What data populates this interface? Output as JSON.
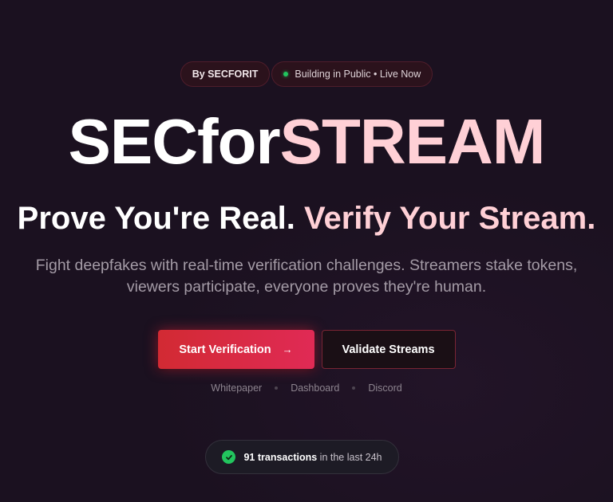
{
  "badges": {
    "author": "By SECFORIT",
    "status": "Building in Public • Live Now"
  },
  "hero": {
    "title_part1": "SECfor",
    "title_part2": "STREAM",
    "tagline_part1": "Prove You're Real.",
    "tagline_part2": "Verify Your Stream.",
    "description": "Fight deepfakes with real-time verification challenges. Streamers stake tokens, viewers participate, everyone proves they're human."
  },
  "actions": {
    "primary_label": "Start Verification",
    "primary_icon": "arrow-right-icon",
    "secondary_label": "Validate Streams"
  },
  "links": [
    "Whitepaper",
    "Dashboard",
    "Discord"
  ],
  "stats": {
    "count_label": "91 transactions",
    "suffix": "in the last 24h",
    "icon": "check-circle-icon"
  },
  "colors": {
    "background": "#1b1120",
    "accent_red": "#dc2634",
    "accent_pink": "#ffd0d6",
    "live_green": "#22c55e"
  }
}
